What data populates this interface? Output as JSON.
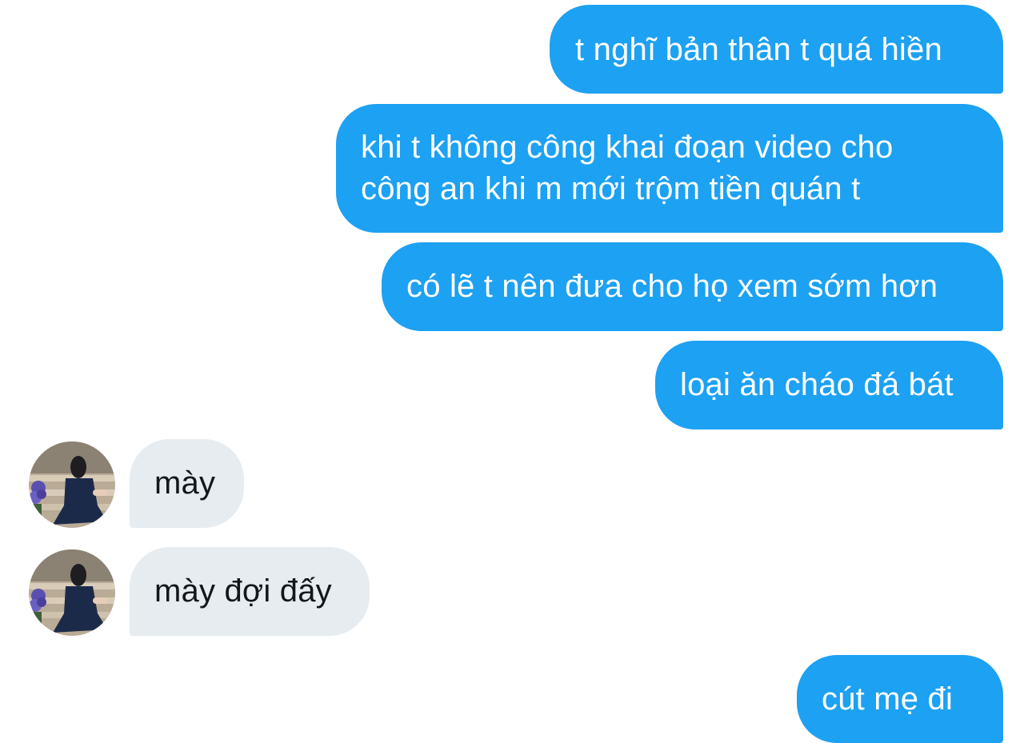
{
  "conversation": {
    "messages": [
      {
        "sender": "me",
        "text": "t nghĩ bản thân t quá hiền"
      },
      {
        "sender": "me",
        "lines": [
          "khi t không công khai đoạn video cho",
          "công an khi m mới trộm tiền quán t"
        ]
      },
      {
        "sender": "me",
        "text": "có lẽ t nên đưa cho họ xem sớm hơn"
      },
      {
        "sender": "me",
        "text": "loại ăn cháo đá bát"
      },
      {
        "sender": "other",
        "text": "mày"
      },
      {
        "sender": "other",
        "text": "mày đợi đấy"
      },
      {
        "sender": "me",
        "text": "cút mẹ đi"
      }
    ]
  },
  "theme": {
    "outgoing_bubble_color": "#1da1f2",
    "incoming_bubble_color": "#e6ecf0",
    "outgoing_text_color": "#ffffff",
    "incoming_text_color": "#14171a"
  },
  "icons": {
    "avatar": "contact-avatar-photo"
  }
}
